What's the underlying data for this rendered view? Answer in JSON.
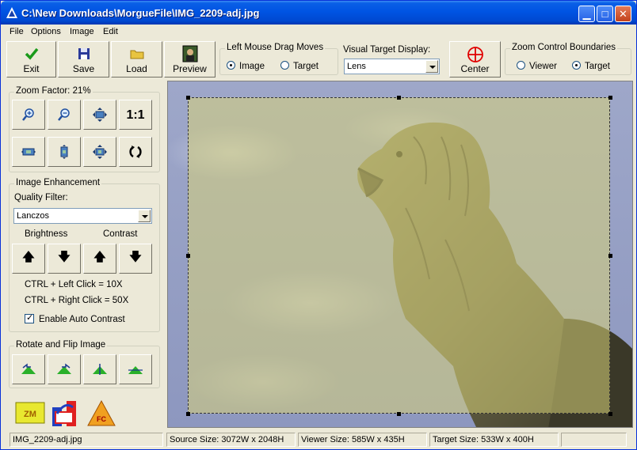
{
  "window": {
    "title": "C:\\New Downloads\\MorgueFile\\IMG_2209-adj.jpg"
  },
  "menu": [
    "File",
    "Options",
    "Image",
    "Edit"
  ],
  "toolbar": {
    "exit": "Exit",
    "save": "Save",
    "load": "Load",
    "preview": "Preview",
    "center": "Center"
  },
  "drag_moves": {
    "legend": "Left Mouse Drag Moves",
    "image": "Image",
    "target": "Target",
    "selected": "image"
  },
  "visual_target": {
    "legend": "Visual Target Display:",
    "value": "Lens"
  },
  "zoom_boundaries": {
    "legend": "Zoom Control Boundaries",
    "viewer": "Viewer",
    "target": "Target",
    "selected": "target"
  },
  "zoom": {
    "legend": "Zoom Factor: 21%",
    "one_to_one": "1:1"
  },
  "enhancement": {
    "legend": "Image Enhancement",
    "quality_label": "Quality Filter:",
    "quality_value": "Lanczos",
    "brightness": "Brightness",
    "contrast": "Contrast",
    "hint1": "CTRL + Left Click = 10X",
    "hint2": "CTRL + Right Click = 50X",
    "auto_contrast": "Enable Auto Contrast",
    "auto_contrast_checked": true
  },
  "rotate": {
    "legend": "Rotate and Flip Image"
  },
  "bottom_icons": {
    "zm": "ZM",
    "fc": "FC"
  },
  "status": {
    "file": "IMG_2209-adj.jpg",
    "source": "Source Size: 3072W x 2048H",
    "viewer": "Viewer Size: 585W x 435H",
    "target": "Target Size: 533W x 400H",
    "extra": ""
  },
  "colors": {
    "title_blue": "#0054e3",
    "exit_green": "#1a9a1a",
    "center_red": "#e00000",
    "target_overlay": "#d7d278"
  }
}
